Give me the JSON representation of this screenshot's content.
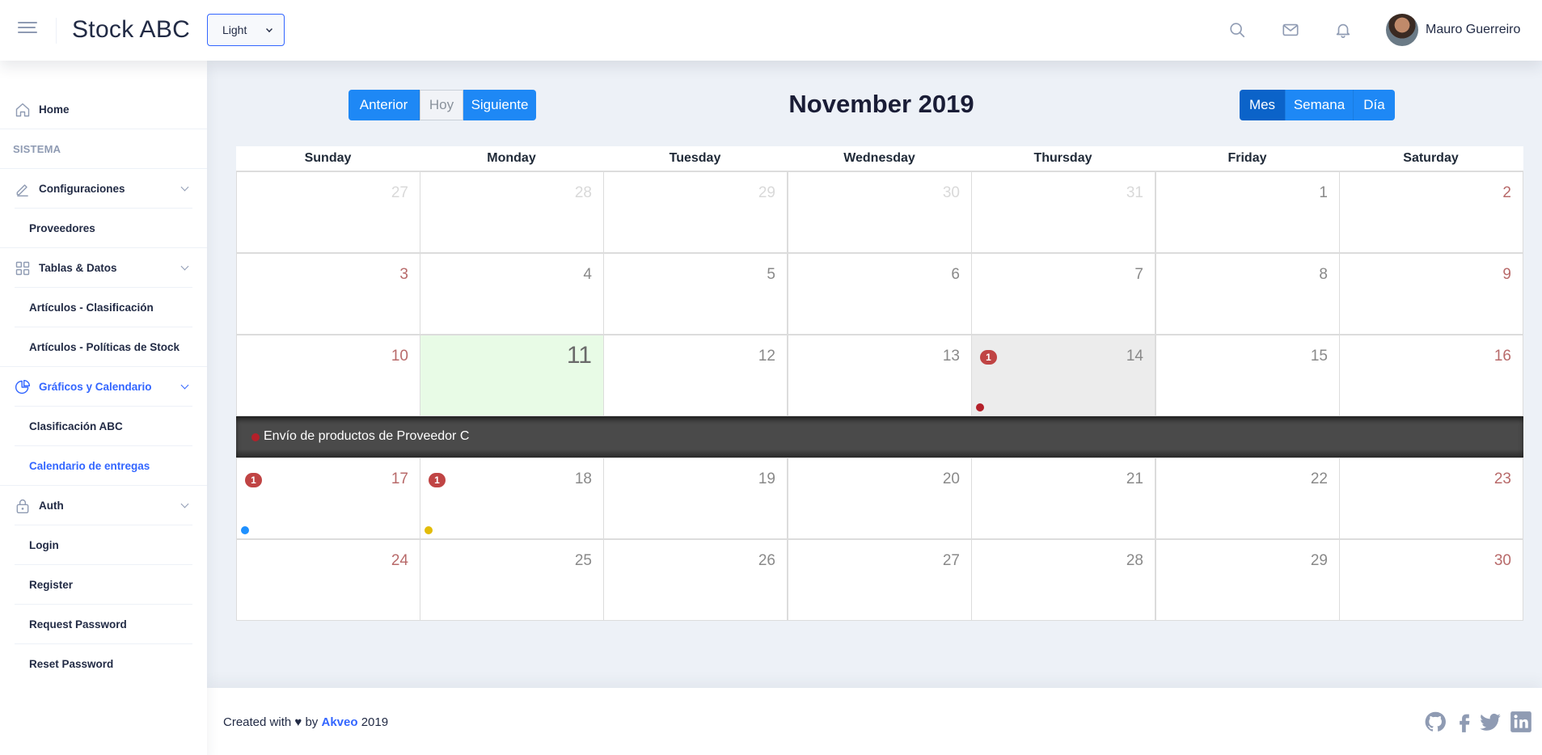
{
  "header": {
    "logo": "Stock ABC",
    "theme": "Light",
    "user_name": "Mauro Guerreiro"
  },
  "sidebar": {
    "home": "Home",
    "group_label": "SISTEMA",
    "configuraciones": "Configuraciones",
    "proveedores": "Proveedores",
    "tablas": "Tablas & Datos",
    "art_clasificacion": "Artículos - Clasificación",
    "art_politicas": "Artículos - Políticas de Stock",
    "graficos": "Gráficos y Calendario",
    "clasificacion_abc": "Clasificación ABC",
    "calendario": "Calendario de entregas",
    "auth": "Auth",
    "login": "Login",
    "register": "Register",
    "request_password": "Request Password",
    "reset_password": "Reset Password"
  },
  "calendar": {
    "nav": {
      "prev": "Anterior",
      "today": "Hoy",
      "next": "Siguiente"
    },
    "title": "November 2019",
    "views": {
      "month": "Mes",
      "week": "Semana",
      "day": "Día"
    },
    "weekdays": [
      "Sunday",
      "Monday",
      "Tuesday",
      "Wednesday",
      "Thursday",
      "Friday",
      "Saturday"
    ],
    "weeks": [
      [
        "27",
        "28",
        "29",
        "30",
        "31",
        "1",
        "2"
      ],
      [
        "3",
        "4",
        "5",
        "6",
        "7",
        "8",
        "9"
      ],
      [
        "10",
        "11",
        "12",
        "13",
        "14",
        "15",
        "16"
      ],
      [
        "17",
        "18",
        "19",
        "20",
        "21",
        "22",
        "23"
      ],
      [
        "24",
        "25",
        "26",
        "27",
        "28",
        "29",
        "30"
      ]
    ],
    "badge_count": "1",
    "event_text": "Envío de productos de Proveedor C",
    "colors": {
      "event_red": "#b4202a",
      "event_blue": "#1e90ff",
      "event_yellow": "#e3bc08",
      "badge": "#c04444",
      "today": "#e8fbe6"
    }
  },
  "footer": {
    "prefix": "Created with",
    "heart": "♥",
    "by": "by",
    "brand": "Akveo",
    "year": "2019"
  }
}
